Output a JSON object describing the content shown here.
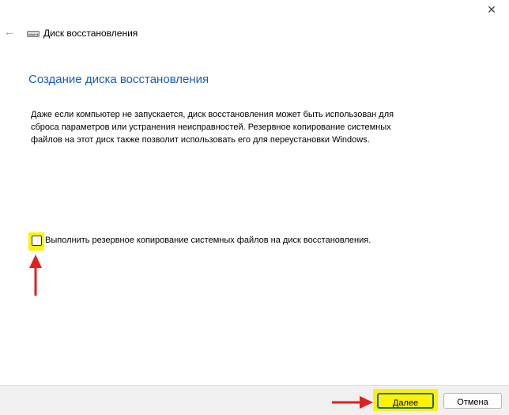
{
  "window": {
    "close_icon": "close-icon",
    "close_glyph": "✕"
  },
  "nav": {
    "back_icon": "back-arrow-icon",
    "back_glyph": "←",
    "drive_icon": "drive-icon",
    "title": "Диск восстановления"
  },
  "main": {
    "heading": "Создание диска восстановления",
    "description_lines": [
      "Даже если компьютер не запускается, диск восстановления может быть использован для",
      "сброса параметров или устранения неисправностей. Резервное копирование системных",
      "файлов на этот диск также позволит использовать его для переустановки Windows."
    ],
    "backup_checkbox": {
      "label": "Выполнить резервное копирование системных файлов на диск восстановления.",
      "checked": false
    }
  },
  "footer": {
    "next_label": "Далее",
    "cancel_label": "Отмена"
  },
  "annotations": {
    "highlight_color": "#fff200",
    "arrow_color": "#e02020"
  }
}
